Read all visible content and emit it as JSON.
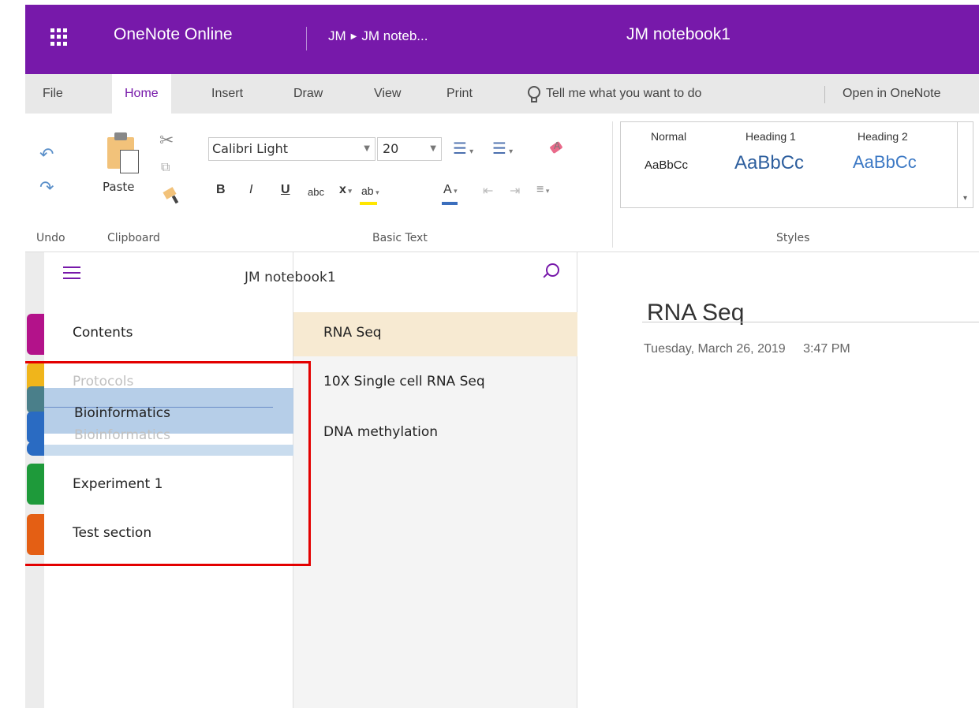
{
  "titlebar": {
    "app_name": "OneNote Online",
    "breadcrumb_root": "JM",
    "breadcrumb_child": "JM noteb...",
    "notebook_title": "JM notebook1",
    "color": "#7719aa"
  },
  "tabs": [
    {
      "label": "File"
    },
    {
      "label": "Home"
    },
    {
      "label": "Insert"
    },
    {
      "label": "Draw"
    },
    {
      "label": "View"
    },
    {
      "label": "Print"
    }
  ],
  "tell_me": "Tell me what you want to do",
  "open_in": "Open in OneNote",
  "ribbon": {
    "undo_group": "Undo",
    "clipboard_group": "Clipboard",
    "paste_label": "Paste",
    "basic_text_group": "Basic Text",
    "font_name": "Calibri Light",
    "font_size": "20",
    "bold": "B",
    "italic": "I",
    "underline": "U",
    "strikethrough": "abc",
    "subscript": "x",
    "highlight": "ab",
    "font_color": "A",
    "styles_group": "Styles",
    "styles": [
      {
        "name": "Normal",
        "preview": "AaBbCc"
      },
      {
        "name": "Heading 1",
        "preview": "AaBbCc"
      },
      {
        "name": "Heading 2",
        "preview": "AaBbCc"
      }
    ]
  },
  "nav": {
    "title": "JM notebook1",
    "sections": [
      {
        "label": "Contents",
        "color": "#b3128a"
      },
      {
        "label": "Protocols",
        "color": "#f0b51b"
      },
      {
        "label": "Bioinformatics",
        "color": "#2a6bc2"
      },
      {
        "label": "Bioinformatics",
        "color": "#2a6bc2"
      },
      {
        "label": "Experiment 1",
        "color": "#1e9a3a"
      },
      {
        "label": "Test section",
        "color": "#e45f14"
      }
    ],
    "pages": [
      {
        "label": "RNA Seq"
      },
      {
        "label": "10X Single cell RNA Seq"
      },
      {
        "label": "DNA methylation"
      }
    ]
  },
  "content": {
    "page_title": "RNA Seq",
    "date": "Tuesday, March 26, 2019",
    "time": "3:47 PM"
  }
}
